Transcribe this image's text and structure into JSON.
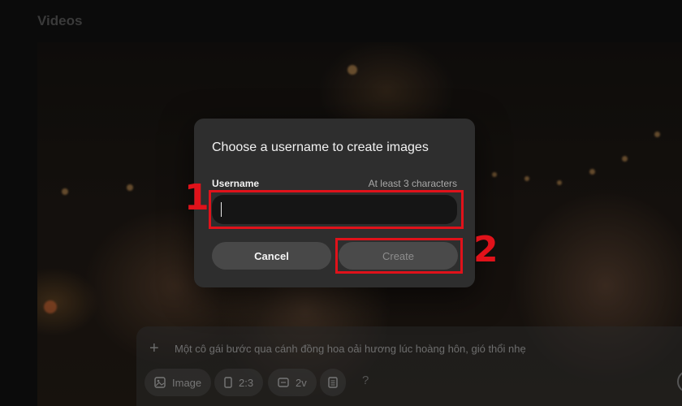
{
  "header": {
    "title": "Videos"
  },
  "modal": {
    "title": "Choose a username to create images",
    "field_label": "Username",
    "field_hint": "At least 3 characters",
    "input_value": "",
    "cancel_label": "Cancel",
    "create_label": "Create"
  },
  "prompt_bar": {
    "placeholder": "Một cô gái bước qua cánh đồng hoa oải hương lúc hoàng hôn, gió thổi nhẹ",
    "chips": [
      {
        "icon": "image-icon",
        "label": "Image"
      },
      {
        "icon": "phone-aspect-icon",
        "label": "2:3"
      },
      {
        "icon": "video-icon",
        "label": "2v"
      },
      {
        "icon": "document-icon",
        "label": ""
      }
    ],
    "help": "?"
  },
  "callouts": [
    {
      "number": "1",
      "color": "#e0121a"
    },
    {
      "number": "2",
      "color": "#e0121a"
    }
  ]
}
